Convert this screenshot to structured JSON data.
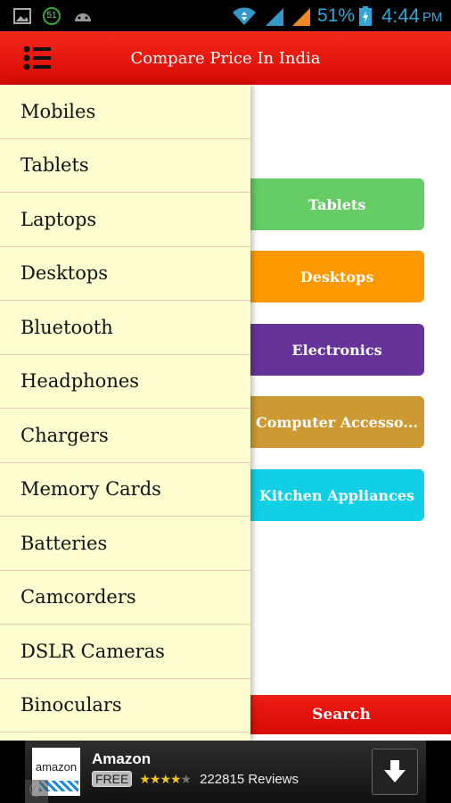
{
  "status_bar": {
    "battery": "51%",
    "time": "4:44",
    "ampm": "PM",
    "notification_badge": "51"
  },
  "app_bar": {
    "title": "Compare Price In India",
    "menu_icon": "list-menu-icon"
  },
  "categories": [
    {
      "label": "Tablets",
      "color": "#66cc66"
    },
    {
      "label": "Desktops",
      "color": "#ff9900"
    },
    {
      "label": "Electronics",
      "color": "#663399"
    },
    {
      "label": "Computer Accesso...",
      "color": "#cc9933"
    },
    {
      "label": "Kitchen Appliances",
      "color": "#11d0e6"
    }
  ],
  "search_label": "Search",
  "drawer": {
    "items": [
      "Mobiles",
      "Tablets",
      "Laptops",
      "Desktops",
      "Bluetooth",
      "Headphones",
      "Chargers",
      "Memory Cards",
      "Batteries",
      "Camcorders",
      "DSLR Cameras",
      "Binoculars",
      ""
    ]
  },
  "ad": {
    "app_name": "Amazon",
    "logo_text": "amazon",
    "price": "FREE",
    "rating": 4.5,
    "reviews": "222815 Reviews"
  }
}
